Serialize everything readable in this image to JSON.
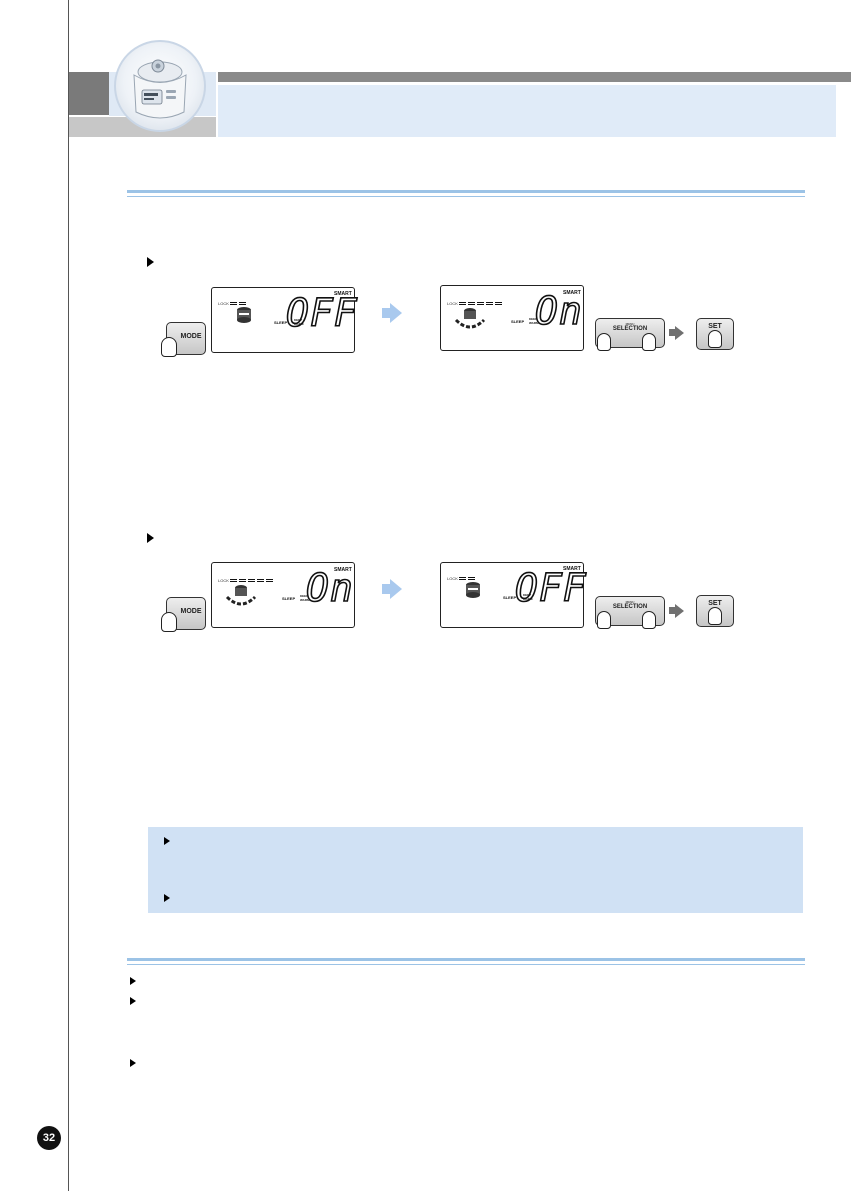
{
  "lcd_panels": [
    {
      "lock_label": "LOCK",
      "smart_label": "SMART",
      "display": "OFF",
      "indicator_top": "SLEEP",
      "indicator_mid": "KEEP",
      "indicator_bot": "WARM"
    },
    {
      "lock_label": "LOCK",
      "smart_label": "SMART",
      "display": "On",
      "indicator_top": "SLEEP",
      "indicator_mid": "KEEP",
      "indicator_bot": "WARM"
    },
    {
      "lock_label": "LOCK",
      "smart_label": "SMART",
      "display": "On",
      "indicator_top": "SLEEP",
      "indicator_mid": "KEEP",
      "indicator_bot": "WARM"
    },
    {
      "lock_label": "LOCK",
      "smart_label": "SMART",
      "display": "OFF",
      "indicator_top": "SLEEP",
      "indicator_mid": "KEEP",
      "indicator_bot": "WARM"
    }
  ],
  "buttons": {
    "mode": {
      "label": "MODE"
    },
    "menu": {
      "line1": "MENU",
      "line2": "SELECTION"
    },
    "set": {
      "label": "SET"
    }
  },
  "page_number": "32",
  "colors": {
    "accent_blue": "#9cc3e6",
    "header_band": "#e0ebf8",
    "note_box": "#d0e1f4"
  }
}
